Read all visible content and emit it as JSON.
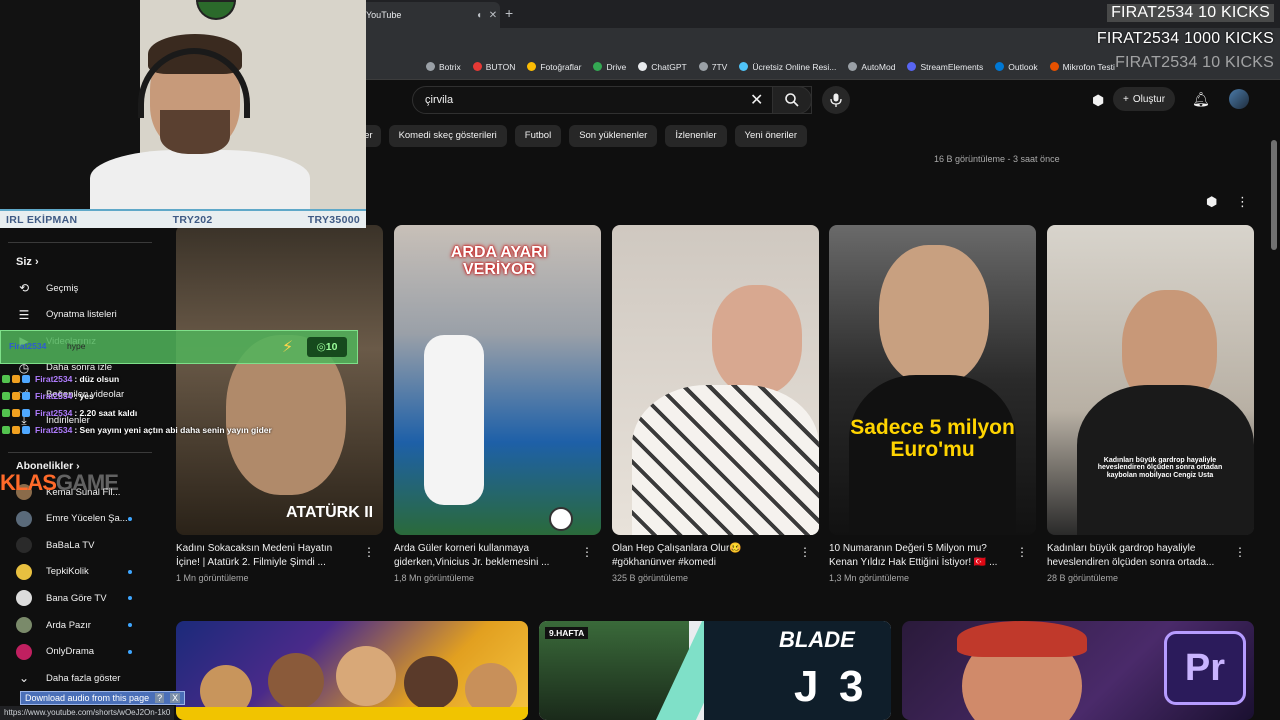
{
  "browser": {
    "tab_title": "YouTube",
    "status_url": "https://www.youtube.com/shorts/wOeJ2On-1k0",
    "bookmarks": [
      {
        "label": "Botrix",
        "color": "#9aa0a6"
      },
      {
        "label": "BUTON",
        "color": "#e53935"
      },
      {
        "label": "Fotoğraflar",
        "color": "#fbbc04"
      },
      {
        "label": "Drive",
        "color": "#34a853"
      },
      {
        "label": "ChatGPT",
        "color": "#e8eaed"
      },
      {
        "label": "7TV",
        "color": "#9aa0a6"
      },
      {
        "label": "Ücretsiz Online Resi...",
        "color": "#4fc3f7"
      },
      {
        "label": "AutoMod",
        "color": "#9aa0a6"
      },
      {
        "label": "StreamElements",
        "color": "#5865f2"
      },
      {
        "label": "Outlook",
        "color": "#0078d4"
      },
      {
        "label": "Mikrofon Testi",
        "color": "#e65100"
      }
    ]
  },
  "header": {
    "search_value": "çirvila",
    "create_label": "Oluştur"
  },
  "chips": [
    "ler",
    "Komedi skeç gösterileri",
    "Futbol",
    "Son yüklenenler",
    "İzlenenler",
    "Yeni öneriler"
  ],
  "top_views": "16 B görüntüleme - 3 saat önce",
  "sidebar": {
    "you_label": "Siz",
    "items": [
      {
        "label": "Geçmiş",
        "icon": "history-icon"
      },
      {
        "label": "Oynatma listeleri",
        "icon": "playlist-icon"
      },
      {
        "label": "Videolarınız",
        "icon": "video-icon"
      },
      {
        "label": "Daha sonra izle",
        "icon": "clock-icon"
      },
      {
        "label": "Beğenilen videolar",
        "icon": "like-icon"
      },
      {
        "label": "İndirilenler",
        "icon": "download-icon"
      }
    ],
    "subs_label": "Abonelikler",
    "subs": [
      {
        "name": "Kemal Sunal Fil...",
        "color": "#8a6b4a",
        "live": false
      },
      {
        "name": "Emre Yücelen Şa...",
        "color": "#5a6a7a",
        "live": true
      },
      {
        "name": "BaBaLa TV",
        "color": "#2a2a2a",
        "live": false
      },
      {
        "name": "TepkiKolik",
        "color": "#e8c040",
        "live": true
      },
      {
        "name": "Bana Göre TV",
        "color": "#dcdcdc",
        "live": true
      },
      {
        "name": "Arda Pazır",
        "color": "#7a8a6a",
        "live": true
      },
      {
        "name": "OnlyDrama",
        "color": "#c02060",
        "live": true
      }
    ],
    "more_label": "Daha fazla göster"
  },
  "shorts": [
    {
      "title": "Kadını Sokacaksın Medeni Hayatın İçine! | Atatürk 2. Filmiyle Şimdi ...",
      "views": "1 Mn görüntüleme",
      "overlay": "ATATÜRK II"
    },
    {
      "title": "Arda Güler korneri kullanmaya giderken,Vinicius Jr. beklemesini ...",
      "views": "1,8 Mn görüntüleme",
      "overlay": "ARDA AYARI VERİYOR"
    },
    {
      "title": "Olan Hep Çalışanlara Olur🥴 #gökhanünver #komedi",
      "views": "325 B görüntüleme",
      "overlay": ""
    },
    {
      "title": "10 Numaranın Değeri 5 Milyon mu? Kenan Yıldız Hak Ettiğini İstiyor! 🇹🇷 ...",
      "views": "1,3 Mn görüntüleme",
      "overlay": "Sadece 5 milyon Euro'mu"
    },
    {
      "title": "Kadınları büyük gardrop hayaliyle heveslendiren ölçüden sonra ortada...",
      "views": "28 B görüntüleme",
      "overlay": "Kadınları büyük gardrop hayaliyle heveslendiren ölçüden sonra ortadan kaybolan mobilyacı Cengiz Usta"
    }
  ],
  "row2": {
    "thumb2_tag": "9.HAFTA",
    "thumb2_title": "BLADE",
    "thumb2_num": "3",
    "thumb3_badge": "Pr"
  },
  "stream": {
    "bar_left": "IRL EKİPMAN",
    "bar_mid": "TRY202",
    "bar_right": "TRY35000",
    "kicks_line1": "FIRAT2534  10 KICKS",
    "kicks_line2": "FIRAT2534  1000 KICKS",
    "kicks_line3": "FIRAT2534  10 KICKS",
    "alert_user": "Firat2534",
    "alert_type": "hype",
    "alert_count": "10",
    "chat": [
      {
        "user": "Firat2534",
        "msg": ": düz olsun"
      },
      {
        "user": "Firat2534",
        "msg": ": yes"
      },
      {
        "user": "Firat2534",
        "msg": ": 2.20 saat kaldı"
      },
      {
        "user": "Firat2534",
        "msg": ": Sen yayını yeni açtın abi daha senin yayın gider"
      }
    ],
    "klas_a": "KLAS",
    "klas_b": "GAME",
    "download_label": "Download audio from this page",
    "download_q": "?",
    "download_x": "X"
  }
}
